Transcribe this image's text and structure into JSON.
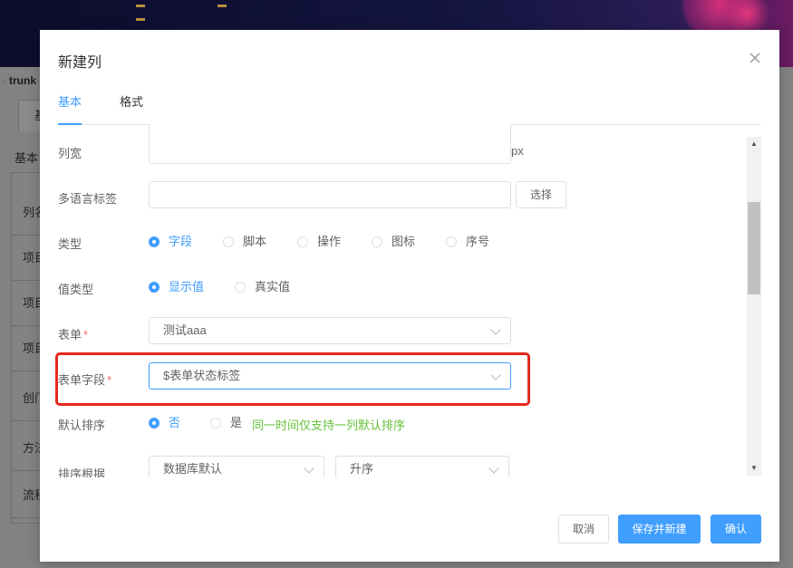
{
  "background": {
    "breadcrumb": "trunk",
    "tab_label": "基",
    "section_label": "基本",
    "rows": [
      "列名",
      "项目",
      "项目",
      "项目",
      "创门",
      "方法",
      "流程"
    ]
  },
  "dialog": {
    "title": "新建列",
    "tabs": [
      {
        "label": "基本",
        "active": true
      },
      {
        "label": "格式",
        "active": false
      }
    ],
    "fields": {
      "column_width": {
        "label": "列宽",
        "value": "",
        "suffix": "px"
      },
      "i18n_label": {
        "label": "多语言标签",
        "value": "",
        "button": "选择"
      },
      "type": {
        "label": "类型",
        "options": [
          "字段",
          "脚本",
          "操作",
          "图标",
          "序号"
        ],
        "selected": "字段"
      },
      "value_type": {
        "label": "值类型",
        "options": [
          "显示值",
          "真实值"
        ],
        "selected": "显示值"
      },
      "form": {
        "label": "表单",
        "required": "*",
        "value": "测试aaa"
      },
      "form_field": {
        "label": "表单字段",
        "required": "*",
        "value": "$表单状态标签"
      },
      "default_sort": {
        "label": "默认排序",
        "options": [
          "否",
          "是"
        ],
        "selected": "否",
        "hint": "同一时间仅支持一列默认排序"
      },
      "sort_basis": {
        "label": "排序根据",
        "value": "数据库默认",
        "order": "升序"
      }
    },
    "buttons": {
      "cancel": "取消",
      "save_and_new": "保存并新建",
      "confirm": "确认"
    }
  },
  "colors": {
    "primary": "#409eff",
    "hint": "#67c23a",
    "required": "#f56c6c",
    "highlight": "#e8271d"
  }
}
